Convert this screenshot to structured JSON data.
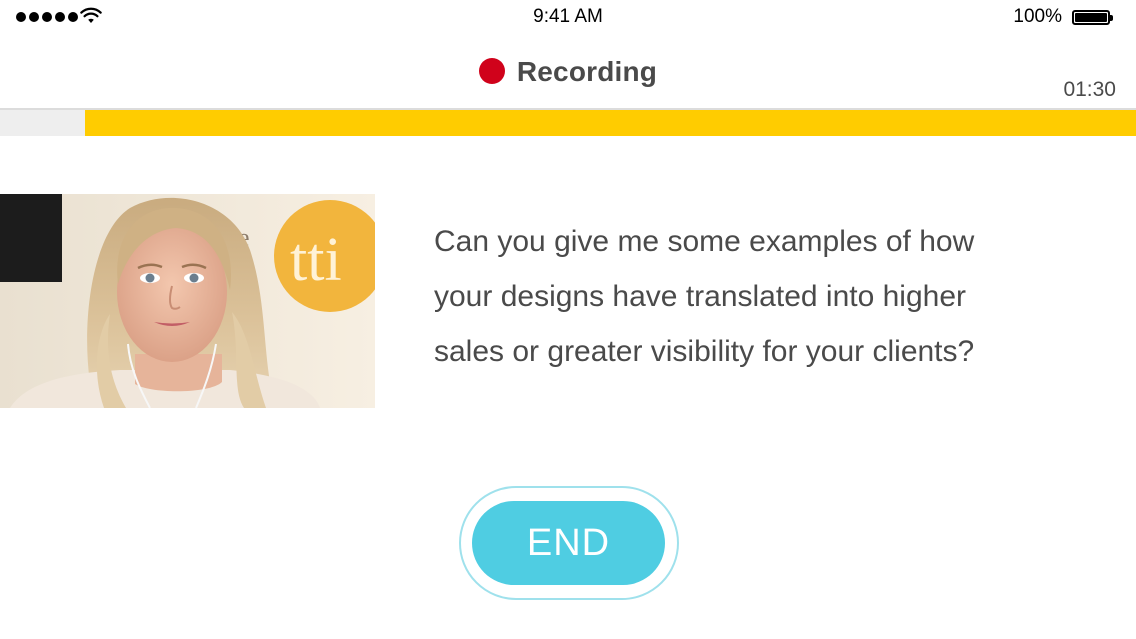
{
  "status_bar": {
    "time": "9:41 AM",
    "battery_percent": "100%",
    "signal_bars": 5
  },
  "header": {
    "title": "Recording",
    "timer": "01:30",
    "record_indicator_color": "#d0021b"
  },
  "progress": {
    "fraction_elapsed": 0.925,
    "fill_color": "#ffcc00"
  },
  "video": {
    "logo_letters": "tti",
    "logo_side_text": "e\ny"
  },
  "question": {
    "lines": [
      "Can you give me some examples of how",
      "your designs have translated into higher",
      "sales or greater visibility for your clients?"
    ]
  },
  "end_button": {
    "label": "END",
    "color": "#4fcde2"
  }
}
